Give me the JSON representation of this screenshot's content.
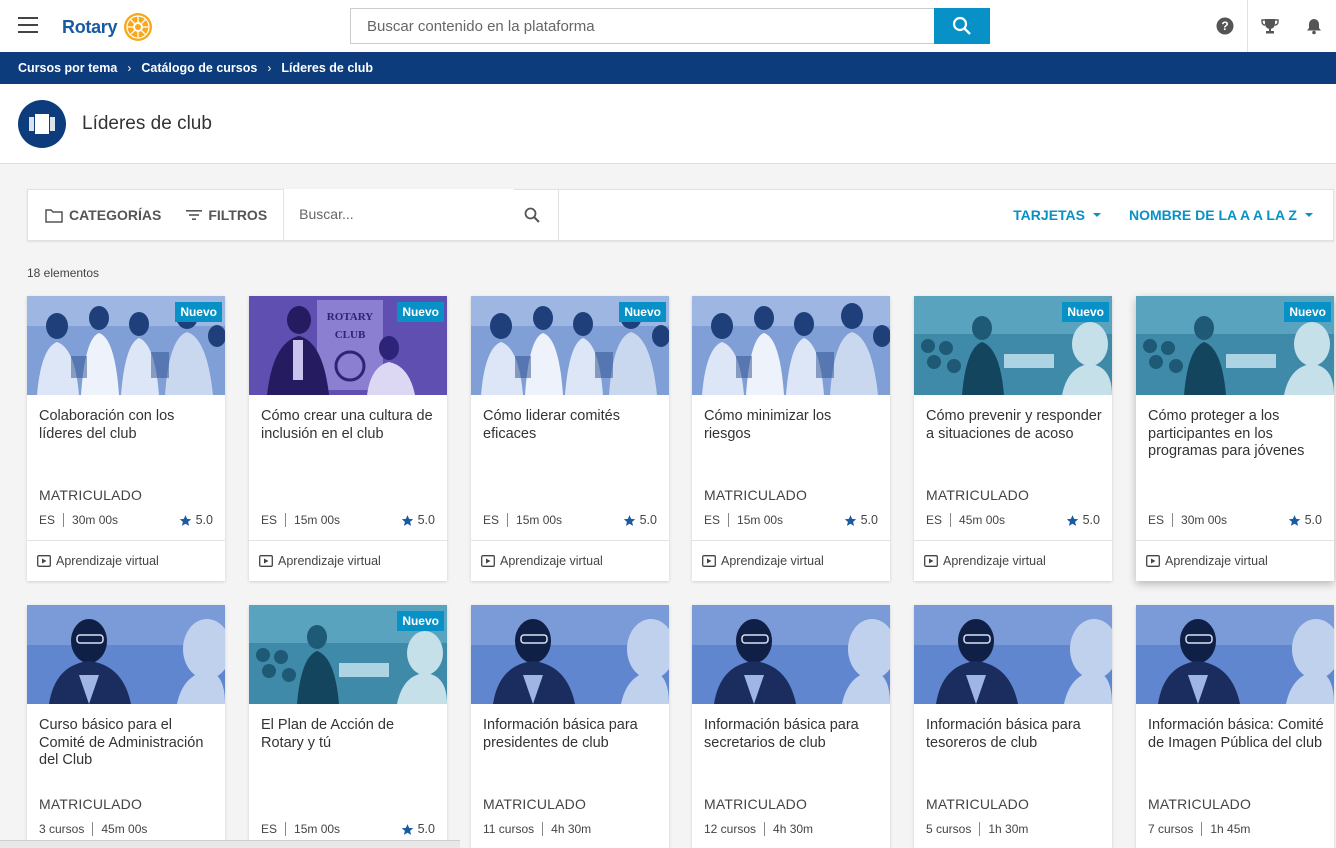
{
  "topbar": {
    "logo_text": "Rotary",
    "search_placeholder": "Buscar contenido en la plataforma",
    "icons": [
      "menu-icon",
      "search-icon",
      "help-icon",
      "trophy-icon",
      "bell-icon"
    ],
    "accent_color": "#0891c6",
    "brand_color": "#0c3c7c"
  },
  "breadcrumb": [
    "Cursos por tema",
    "Catálogo de cursos",
    "Líderes de club"
  ],
  "page": {
    "title": "Líderes de club"
  },
  "toolbar": {
    "categories_label": "CATEGORÍAS",
    "filters_label": "FILTROS",
    "search_placeholder": "Buscar...",
    "view_label": "TARJETAS",
    "sort_label": "NOMBRE DE LA A A LA Z"
  },
  "count_label": "18 elementos",
  "cards": [
    {
      "title": "Colaboración con los líderes del club",
      "badge": "Nuevo",
      "status": "MATRICULADO",
      "lang": "ES",
      "duration": "30m 00s",
      "rating": "5.0",
      "footer": "Aprendizaje virtual",
      "image": "students"
    },
    {
      "title": "Cómo crear una cultura de inclusión en el club",
      "badge": "Nuevo",
      "status": "",
      "lang": "ES",
      "duration": "15m 00s",
      "rating": "5.0",
      "footer": "Aprendizaje virtual",
      "image": "rotary-club"
    },
    {
      "title": "Cómo liderar comités eficaces",
      "badge": "Nuevo",
      "status": "",
      "lang": "ES",
      "duration": "15m 00s",
      "rating": "5.0",
      "footer": "Aprendizaje virtual",
      "image": "students"
    },
    {
      "title": "Cómo minimizar los riesgos",
      "badge": "",
      "status": "MATRICULADO",
      "lang": "ES",
      "duration": "15m 00s",
      "rating": "5.0",
      "footer": "Aprendizaje virtual",
      "image": "students"
    },
    {
      "title": "Cómo prevenir y responder a situaciones de acoso",
      "badge": "Nuevo",
      "status": "MATRICULADO",
      "lang": "ES",
      "duration": "45m 00s",
      "rating": "5.0",
      "footer": "Aprendizaje virtual",
      "image": "meeting"
    },
    {
      "title": "Cómo proteger a los participantes en los programas para jóvenes",
      "badge": "Nuevo",
      "status": "",
      "lang": "ES",
      "duration": "30m 00s",
      "rating": "5.0",
      "footer": "Aprendizaje virtual",
      "image": "meeting"
    },
    {
      "title": "Curso básico para el Comité de Administración del Club",
      "badge": "",
      "status": "MATRICULADO",
      "lang": "3 cursos",
      "duration": "45m 00s",
      "rating": "",
      "footer": "",
      "image": "speaker"
    },
    {
      "title": "El Plan de Acción de Rotary y tú",
      "badge": "Nuevo",
      "status": "",
      "lang": "ES",
      "duration": "15m 00s",
      "rating": "5.0",
      "footer": "",
      "image": "meeting"
    },
    {
      "title": "Información básica para presidentes de club",
      "badge": "",
      "status": "MATRICULADO",
      "lang": "11 cursos",
      "duration": "4h 30m",
      "rating": "",
      "footer": "",
      "image": "speaker"
    },
    {
      "title": "Información básica para secretarios de club",
      "badge": "",
      "status": "MATRICULADO",
      "lang": "12 cursos",
      "duration": "4h 30m",
      "rating": "",
      "footer": "",
      "image": "speaker"
    },
    {
      "title": "Información básica para tesoreros de club",
      "badge": "",
      "status": "MATRICULADO",
      "lang": "5 cursos",
      "duration": "1h 30m",
      "rating": "",
      "footer": "",
      "image": "speaker"
    },
    {
      "title": "Información básica: Comité de Imagen Pública del club",
      "badge": "",
      "status": "MATRICULADO",
      "lang": "7 cursos",
      "duration": "1h 45m",
      "rating": "",
      "footer": "",
      "image": "speaker"
    }
  ]
}
